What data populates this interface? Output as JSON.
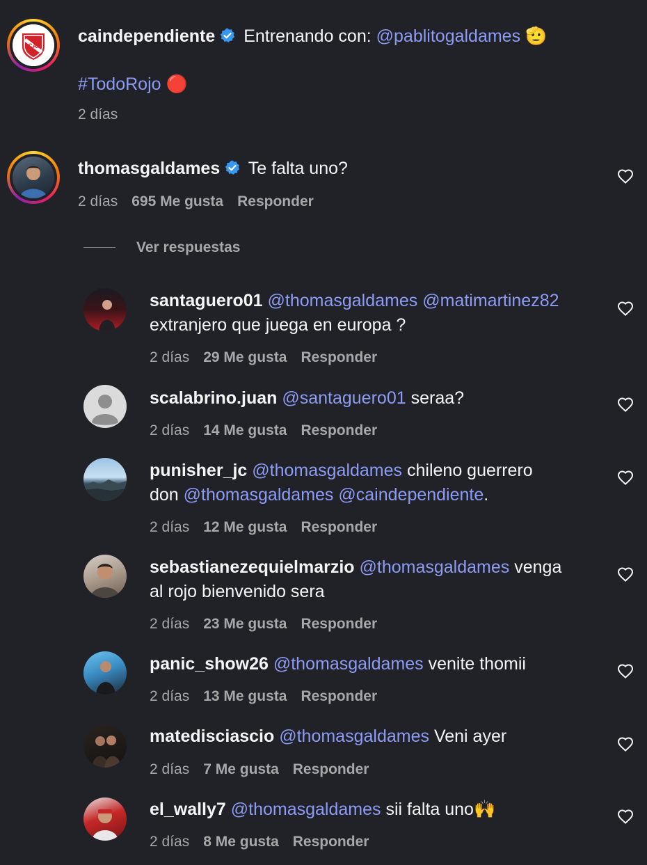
{
  "post": {
    "user": "caindependiente",
    "text_prefix": "Entrenando con: ",
    "mention": "@pablitogaldames",
    "emoji": "🫡",
    "hashtag": "#TodoRojo",
    "hashtag_emoji": "🔴",
    "time": "2 días"
  },
  "top_comment": {
    "user": "thomasgaldames",
    "text": "Te falta uno?",
    "time": "2 días",
    "likes": "695 Me gusta",
    "reply": "Responder"
  },
  "view_replies": "Ver respuestas",
  "replies": [
    {
      "user": "santaguero01",
      "mention1": "@thomasgaldames",
      "mention2": "@matimartinez82",
      "line2": "extranjero que juega en europa ?",
      "time": "2 días",
      "likes": "29 Me gusta",
      "reply": "Responder"
    },
    {
      "user": "scalabrino.juan",
      "mention": "@santaguero01",
      "text": "seraa?",
      "time": "2 días",
      "likes": "14 Me gusta",
      "reply": "Responder"
    },
    {
      "user": "punisher_jc",
      "mention": "@thomasgaldames",
      "text": "chileno guerrero",
      "line2_prefix": "don ",
      "mention2": "@thomasgaldames",
      "mention3": "@caindependiente",
      "line2_suffix": ".",
      "time": "2 días",
      "likes": "12 Me gusta",
      "reply": "Responder"
    },
    {
      "user": "sebastianezequielmarzio",
      "mention": "@thomasgaldames",
      "text": "venga",
      "line2": "al rojo bienvenido sera",
      "time": "2 días",
      "likes": "23 Me gusta",
      "reply": "Responder"
    },
    {
      "user": "panic_show26",
      "mention": "@thomasgaldames",
      "text": "venite thomii",
      "time": "2 días",
      "likes": "13 Me gusta",
      "reply": "Responder"
    },
    {
      "user": "matedisciascio",
      "mention": "@thomasgaldames",
      "text": "Veni ayer",
      "time": "2 días",
      "likes": "7 Me gusta",
      "reply": "Responder"
    },
    {
      "user": "el_wally7",
      "mention": "@thomasgaldames",
      "text": "sii falta uno🙌",
      "time": "2 días",
      "likes": "8 Me gusta",
      "reply": "Responder"
    }
  ],
  "colors": {
    "background": "#212128",
    "mention": "#8c9cf5",
    "verified": "#3897f0",
    "meta": "#a8a8a8"
  }
}
